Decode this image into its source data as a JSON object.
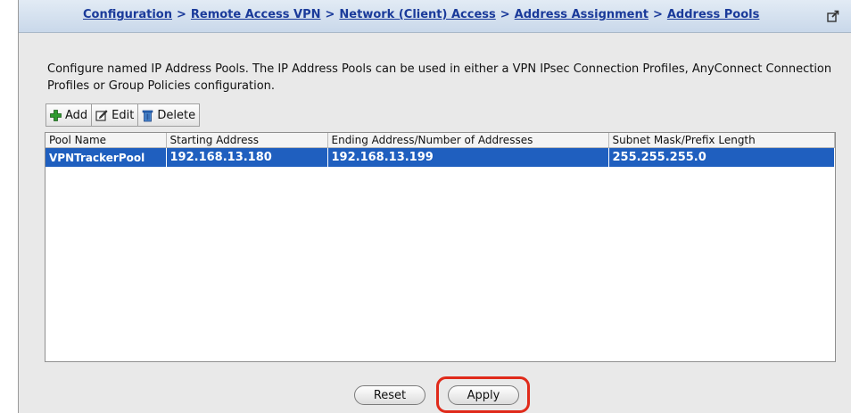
{
  "breadcrumb": {
    "items": [
      "Configuration",
      "Remote Access VPN",
      "Network (Client) Access",
      "Address Assignment",
      "Address Pools"
    ],
    "separator": ">"
  },
  "description": "Configure named IP Address Pools. The IP Address Pools can be used in either a VPN IPsec Connection Profiles, AnyConnect Connection Profiles or Group Policies configuration.",
  "toolbar": {
    "add_label": "Add",
    "edit_label": "Edit",
    "delete_label": "Delete"
  },
  "table": {
    "columns": [
      "Pool Name",
      "Starting Address",
      "Ending Address/Number of Addresses",
      "Subnet Mask/Prefix Length"
    ],
    "rows": [
      {
        "pool_name": "VPNTrackerPool",
        "starting_address": "192.168.13.180",
        "ending_address": "192.168.13.199",
        "subnet_mask": "255.255.255.0",
        "selected": true
      }
    ]
  },
  "buttons": {
    "reset_label": "Reset",
    "apply_label": "Apply"
  },
  "icons": {
    "add": "plus-icon",
    "edit": "edit-icon",
    "delete": "trash-icon",
    "popout": "popout-icon"
  },
  "colors": {
    "selection": "#1f5fbf",
    "link": "#1a3a9a",
    "highlight": "#e02a1a"
  }
}
